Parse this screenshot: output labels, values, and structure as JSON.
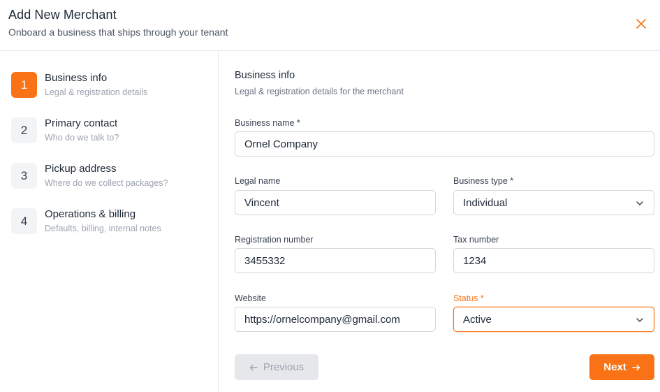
{
  "header": {
    "title": "Add New Merchant",
    "subtitle": "Onboard a business that ships through your tenant",
    "close_icon": "close-icon"
  },
  "steps": [
    {
      "number": "1",
      "title": "Business info",
      "description": "Legal & registration details",
      "active": true
    },
    {
      "number": "2",
      "title": "Primary contact",
      "description": "Who do we talk to?",
      "active": false
    },
    {
      "number": "3",
      "title": "Pickup address",
      "description": "Where do we collect packages?",
      "active": false
    },
    {
      "number": "4",
      "title": "Operations & billing",
      "description": "Defaults, billing, internal notes",
      "active": false
    }
  ],
  "section": {
    "title": "Business info",
    "description": "Legal & registration details for the merchant"
  },
  "form": {
    "business_name": {
      "label": "Business name *",
      "value": "Ornel Company"
    },
    "legal_name": {
      "label": "Legal name",
      "value": "Vincent"
    },
    "business_type": {
      "label": "Business type *",
      "value": "Individual"
    },
    "registration_number": {
      "label": "Registration number",
      "value": "3455332"
    },
    "tax_number": {
      "label": "Tax number",
      "value": "1234"
    },
    "website": {
      "label": "Website",
      "value": "https://ornelcompany@gmail.com"
    },
    "status": {
      "label": "Status *",
      "value": "Active"
    }
  },
  "footer": {
    "previous_label": "Previous",
    "next_label": "Next"
  },
  "colors": {
    "accent": "#f97316",
    "border": "#d1d5db",
    "muted_text": "#9ca3af"
  }
}
